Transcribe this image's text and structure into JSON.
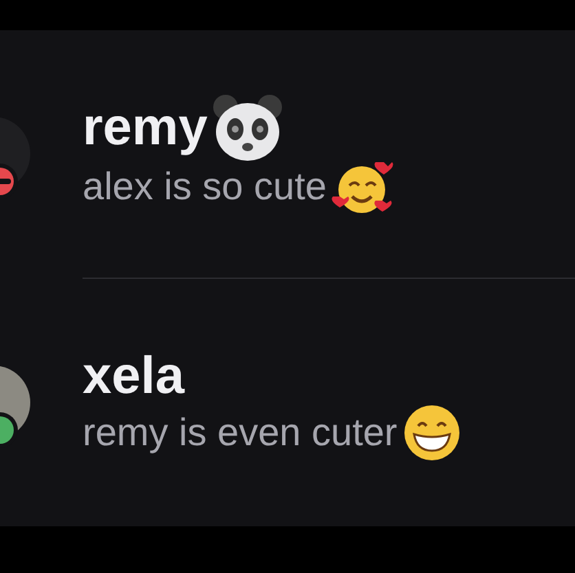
{
  "conversations": [
    {
      "name": "remy",
      "message": "alex is so cute",
      "status": {
        "kind": "dnd",
        "color": "#e5484d"
      }
    },
    {
      "name": "xela",
      "message": "remy is even cuter",
      "status": {
        "kind": "online",
        "color": "#4caf62"
      }
    }
  ]
}
